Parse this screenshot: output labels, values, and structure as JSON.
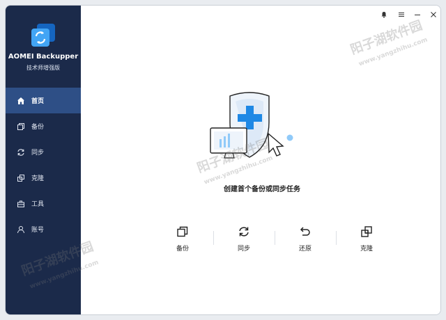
{
  "app": {
    "name": "AOMEI Backupper",
    "edition": "技术师增强版"
  },
  "sidebar": {
    "items": [
      {
        "label": "首页",
        "icon": "home-icon",
        "active": true
      },
      {
        "label": "备份",
        "icon": "backup-icon",
        "active": false
      },
      {
        "label": "同步",
        "icon": "sync-icon",
        "active": false
      },
      {
        "label": "克隆",
        "icon": "clone-icon",
        "active": false
      },
      {
        "label": "工具",
        "icon": "tools-icon",
        "active": false
      },
      {
        "label": "账号",
        "icon": "account-icon",
        "active": false
      }
    ]
  },
  "main": {
    "task_title": "创建首个备份或同步任务",
    "actions": [
      {
        "label": "备份",
        "icon": "backup-icon"
      },
      {
        "label": "同步",
        "icon": "sync-icon"
      },
      {
        "label": "还原",
        "icon": "restore-icon"
      },
      {
        "label": "克隆",
        "icon": "clone-icon"
      }
    ]
  },
  "watermark": {
    "name": "阳子湖软件园",
    "url": "www.yangzhihu.com"
  },
  "colors": {
    "sidebar_bg": "#1b2a4a",
    "sidebar_active": "#2e4f86",
    "accent": "#1e88e5"
  }
}
